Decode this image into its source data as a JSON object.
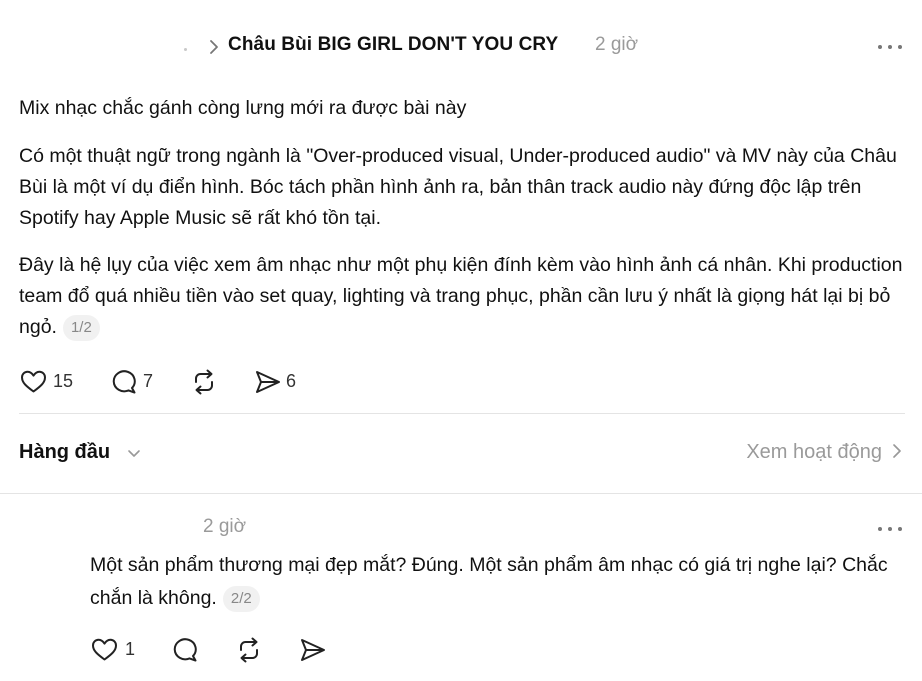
{
  "post": {
    "author_title": "Châu Bùi BIG GIRL DON'T YOU CRY",
    "time": "2 giờ",
    "paragraphs": [
      "Mix nhạc chắc gánh còng lưng mới ra được bài này",
      "Có một thuật ngữ trong ngành là \"Over-produced visual, Under-produced audio\" và MV này của Châu Bùi là một ví dụ điển hình. Bóc tách phần hình ảnh ra, bản thân track audio này đứng độc lập trên Spotify hay Apple Music sẽ rất khó tồn tại.",
      "Đây là hệ lụy của việc xem âm nhạc như một phụ kiện đính kèm vào hình ảnh cá nhân. Khi production team đổ quá nhiều tiền vào set quay, lighting và trang phục, phần cần lưu ý nhất là giọng hát lại bị bỏ ngỏ."
    ],
    "page_indicator": "1/2",
    "actions": {
      "likes": "15",
      "comments": "7",
      "reposts": "",
      "shares": "6"
    }
  },
  "sort": {
    "label": "Hàng đầu",
    "view_activity": "Xem hoạt động"
  },
  "reply": {
    "time": "2 giờ",
    "text": "Một sản phẩm thương mại đẹp mắt? Đúng. Một sản phẩm âm nhạc có giá trị nghe lại? Chắc chắn là không.",
    "page_indicator": "2/2",
    "actions": {
      "likes": "1"
    }
  },
  "icons": {
    "like": "heart-icon",
    "comment": "comment-bubble-icon",
    "repost": "repost-icon",
    "share": "send-icon",
    "more": "more-dots-icon",
    "chevron_right": "chevron-right-icon",
    "chevron_down": "chevron-down-icon"
  }
}
